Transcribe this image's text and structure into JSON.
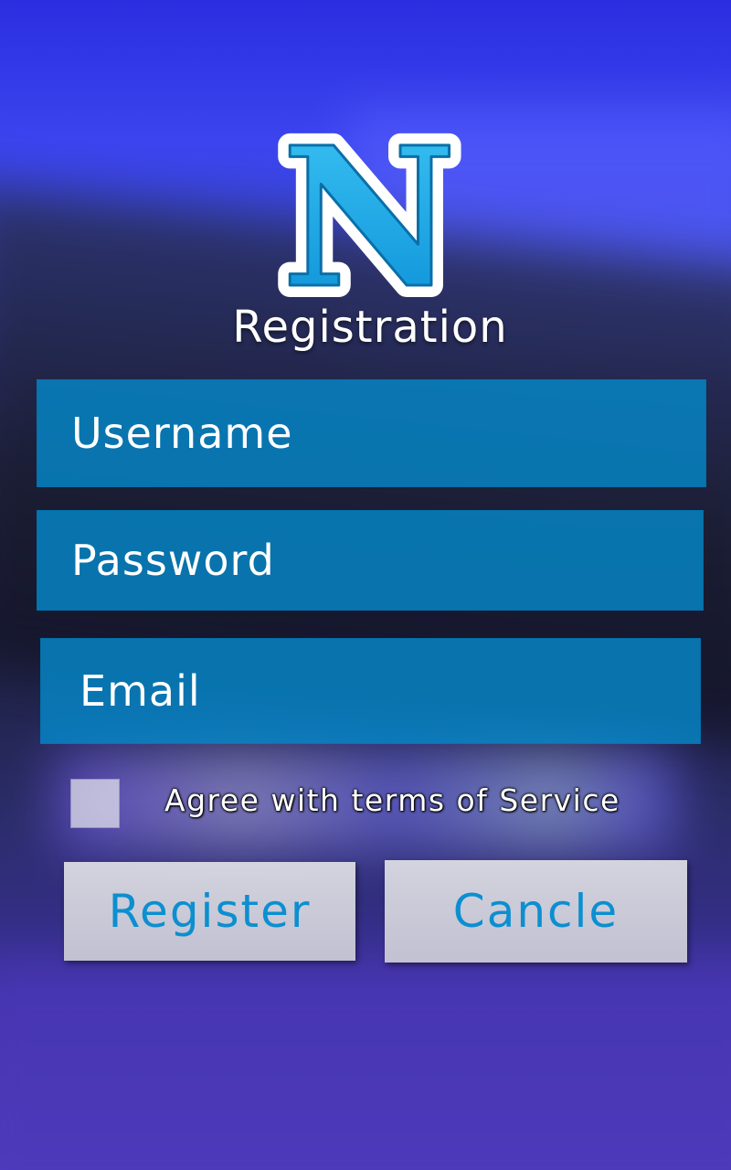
{
  "app": {
    "logo_letter": "N",
    "title": "Registration"
  },
  "form": {
    "username_placeholder": "Username",
    "password_placeholder": "Password",
    "email_placeholder": "Email",
    "agree_label": "Agree with terms of Service",
    "agree_checked": false
  },
  "buttons": {
    "register_label": "Register",
    "cancel_label": "Cancle"
  },
  "colors": {
    "field_bg": "#0587c8",
    "button_text": "#0b8fd0",
    "logo_fill": "#1aa7e8",
    "logo_outline": "#ffffff"
  }
}
